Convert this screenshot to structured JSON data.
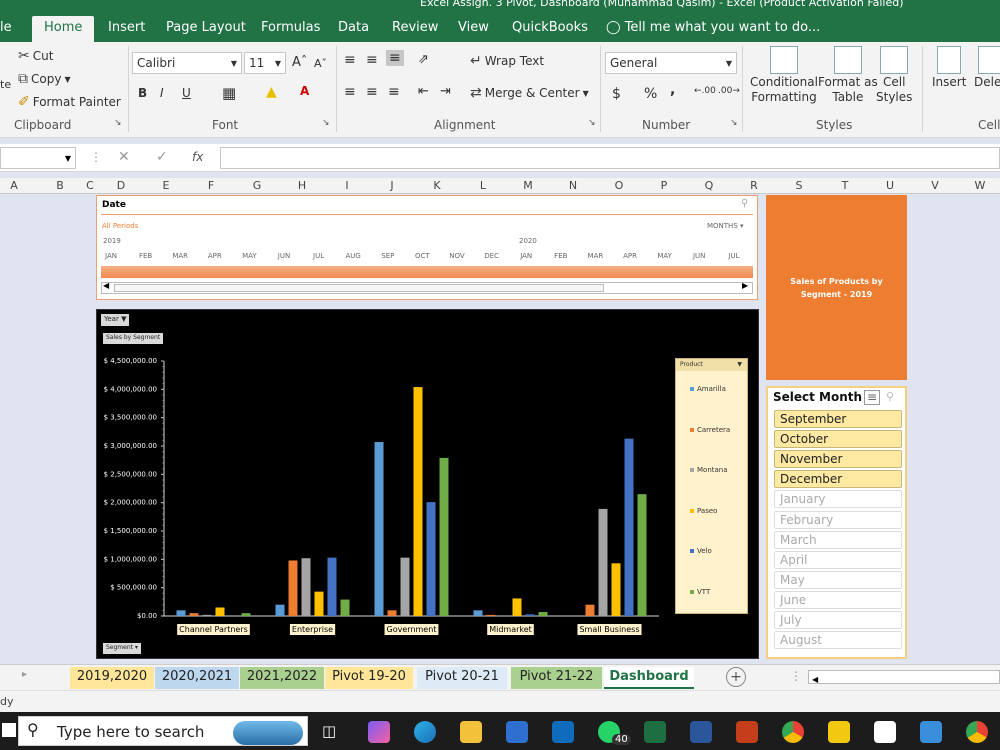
{
  "app": {
    "title": "Excel Assign. 3 Pivot, Dashboard (Muhammad Qasim) - Excel (Product Activation Failed)"
  },
  "ribbon_tabs": [
    "le",
    "Home",
    "Insert",
    "Page Layout",
    "Formulas",
    "Data",
    "Review",
    "View",
    "QuickBooks"
  ],
  "tell_me": "Tell me what you want to do...",
  "clipboard": {
    "cut": "Cut",
    "copy": "Copy",
    "format_painter": "Format Painter",
    "group": "Clipboard",
    "paste_partial": "te"
  },
  "font": {
    "name": "Calibri",
    "size": "11",
    "group": "Font"
  },
  "alignment": {
    "wrap": "Wrap Text",
    "merge": "Merge & Center",
    "group": "Alignment"
  },
  "number": {
    "format": "General",
    "group": "Number",
    "currency": "$",
    "percent": "%",
    "comma": ","
  },
  "styles": {
    "conditional": "Conditional",
    "conditional2": "Formatting",
    "format_as": "Format as",
    "format_as2": "Table",
    "cell_styles": "Cell",
    "cell_styles2": "Styles",
    "group": "Styles"
  },
  "cells": {
    "insert": "Insert",
    "delete": "Delet",
    "group": "Cells"
  },
  "formula": {
    "name_box": "",
    "fx": "fx"
  },
  "columns": [
    "A",
    "B",
    "C",
    "D",
    "E",
    "F",
    "G",
    "H",
    "I",
    "J",
    "K",
    "L",
    "M",
    "N",
    "O",
    "P",
    "Q",
    "R",
    "S",
    "T",
    "U",
    "V",
    "W"
  ],
  "timeline": {
    "title": "Date",
    "period": "All Periods",
    "unit": "MONTHS",
    "year1": "2019",
    "year2": "2020",
    "months": [
      "JAN",
      "FEB",
      "MAR",
      "APR",
      "MAY",
      "JUN",
      "JUL",
      "AUG",
      "SEP",
      "OCT",
      "NOV",
      "DEC",
      "JAN",
      "FEB",
      "MAR",
      "APR",
      "MAY",
      "JUN",
      "JUL"
    ]
  },
  "chart_ui": {
    "year_btn": "Year",
    "sales_btn": "Sales by Segment",
    "segment_btn": "Segment",
    "legend_title": "Product"
  },
  "chart_data": {
    "type": "bar",
    "categories": [
      "Channel Partners",
      "Enterprise",
      "Government",
      "Midmarket",
      "Small Business"
    ],
    "series": [
      {
        "name": "Amarilla",
        "color": "#5b9bd5",
        "values": [
          100000,
          200000,
          3070000,
          100000,
          0
        ]
      },
      {
        "name": "Carretera",
        "color": "#ed7d31",
        "values": [
          50000,
          980000,
          100000,
          20000,
          200000
        ]
      },
      {
        "name": "Montana",
        "color": "#a5a5a5",
        "values": [
          20000,
          1020000,
          1030000,
          0,
          1890000
        ]
      },
      {
        "name": "Paseo",
        "color": "#ffc000",
        "values": [
          150000,
          430000,
          4040000,
          310000,
          930000
        ]
      },
      {
        "name": "Velo",
        "color": "#4472c4",
        "values": [
          0,
          1030000,
          2010000,
          30000,
          3130000
        ]
      },
      {
        "name": "VTT",
        "color": "#70ad47",
        "values": [
          50000,
          290000,
          2790000,
          70000,
          2150000
        ]
      }
    ],
    "yticks": [
      "$ 4,500,000.00",
      "$ 4,000,000.00",
      "$ 3,500,000.00",
      "$ 3,000,000.00",
      "$ 2,500,000.00",
      "$ 2,000,000.00",
      "$ 1,500,000.00",
      "$ 1,000,000.00",
      "$ 500,000.00",
      "$0.00"
    ],
    "ylim": [
      0,
      4500000
    ],
    "legend": "right"
  },
  "panel": {
    "title": "Sales of Products by Segment  - 2019"
  },
  "slicer": {
    "title": "Select Month",
    "months": [
      {
        "label": "September",
        "selected": true
      },
      {
        "label": "October",
        "selected": true
      },
      {
        "label": "November",
        "selected": true
      },
      {
        "label": "December",
        "selected": true
      },
      {
        "label": "January",
        "selected": false
      },
      {
        "label": "February",
        "selected": false
      },
      {
        "label": "March",
        "selected": false
      },
      {
        "label": "April",
        "selected": false
      },
      {
        "label": "May",
        "selected": false
      },
      {
        "label": "June",
        "selected": false
      },
      {
        "label": "July",
        "selected": false
      },
      {
        "label": "August",
        "selected": false
      }
    ]
  },
  "sheet_tabs": [
    {
      "label": "2019,2020",
      "color": "#ffe699"
    },
    {
      "label": "2020,2021",
      "color": "#bdd7ee"
    },
    {
      "label": "2021,2022",
      "color": "#a9d08e"
    },
    {
      "label": "Pivot 19-20",
      "color": "#ffe699"
    },
    {
      "label": "Pivot 20-21",
      "color": "#ddebf7"
    },
    {
      "label": "Pivot 21-22",
      "color": "#a9d08e"
    },
    {
      "label": "Dashboard",
      "color": "#ffffff"
    }
  ],
  "status": {
    "ready": "dy"
  },
  "taskbar": {
    "search": "Type here to search",
    "badge": "40"
  }
}
